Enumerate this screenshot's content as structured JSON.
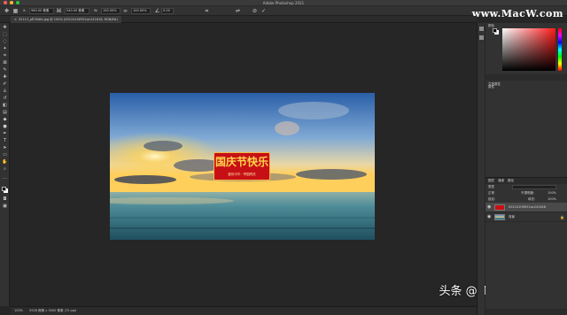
{
  "window": {
    "title": "Adobe Photoshop 2021",
    "traffic_colors": [
      "#ff5f57",
      "#febc2e",
      "#28c840"
    ]
  },
  "options_bar": {
    "width_value": "960.00 像素",
    "height_value": "540.00 像素",
    "zoom_w": "100.00%",
    "zoom_h": "100.00%",
    "angle": "0.00"
  },
  "watermark": "www.MacW.com",
  "document_tab": {
    "name": "52113_pR30dfe.jpg @ 100% (001241f4f921ac241616, RGB/8#)"
  },
  "image_banner": {
    "main_text": "国庆节快乐",
    "sub_text": "盛世中华 · 举国同庆"
  },
  "status_bar": {
    "zoom": "100%",
    "doc_info": "5926 像素 x 3000 像素 (72 ppi)"
  },
  "credit": "头条 @Mac小小木子李",
  "panels": {
    "color_title": "颜色",
    "props_tab": "属性",
    "props_sub": "文档属性",
    "layers_tabs": [
      "图层",
      "通道",
      "路径"
    ],
    "kind_label": "类型",
    "blend_mode": "正常",
    "opacity_label": "不透明度:",
    "opacity_value": "100%",
    "lock_label": "锁定:",
    "fill_label": "填充:",
    "fill_value": "100%",
    "layers": [
      {
        "name": "001241f4f921ac241616",
        "selected": true
      },
      {
        "name": "背景",
        "selected": false
      }
    ]
  },
  "colors": {
    "sky_top": "#2c6fb8",
    "sky_mid": "#8fb7dd",
    "sun": "#ffd35a",
    "sea": "#3d7f93",
    "banner": "#d1121b"
  }
}
